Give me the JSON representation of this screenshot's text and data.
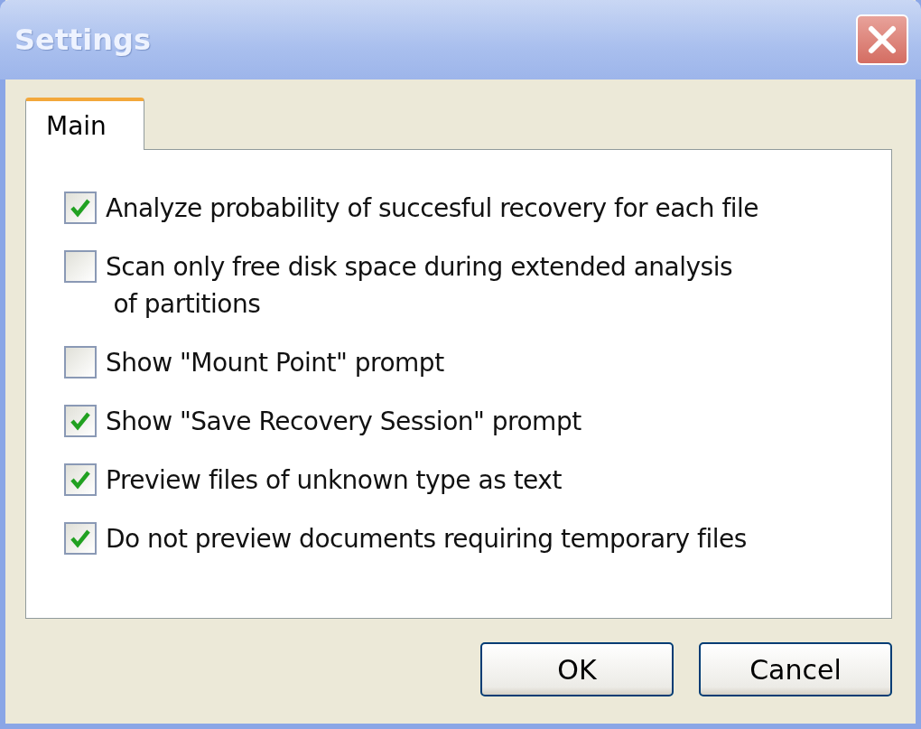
{
  "window": {
    "title": "Settings"
  },
  "tabs": [
    {
      "label": "Main",
      "selected": true
    }
  ],
  "options": [
    {
      "label": "Analyze probability of succesful recovery for each file",
      "checked": true
    },
    {
      "label": "Scan only free disk space during extended analysis\n of partitions",
      "checked": false
    },
    {
      "label": "Show \"Mount Point\" prompt",
      "checked": false
    },
    {
      "label": "Show \"Save Recovery Session\" prompt",
      "checked": true
    },
    {
      "label": "Preview files of unknown type as text",
      "checked": true
    },
    {
      "label": "Do not preview documents requiring temporary files",
      "checked": true
    }
  ],
  "buttons": [
    "OK",
    "Cancel"
  ]
}
